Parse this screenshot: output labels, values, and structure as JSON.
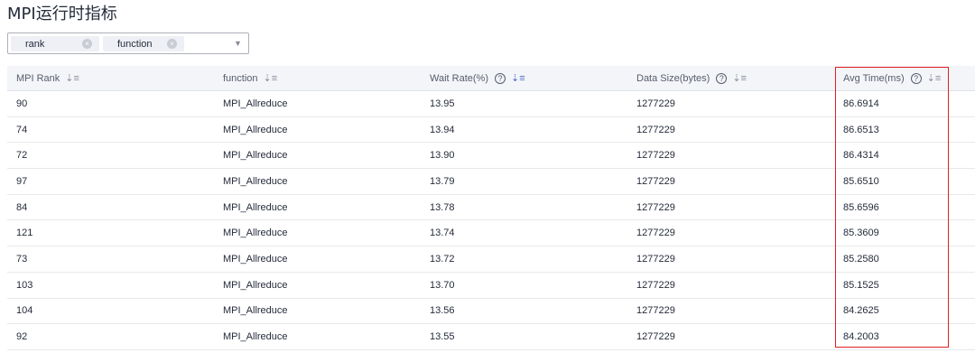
{
  "page": {
    "title": "MPI运行时指标"
  },
  "filter": {
    "tags": [
      {
        "label": "rank"
      },
      {
        "label": "function"
      }
    ],
    "close_glyph": "×",
    "arrow_icon": "chevron-down-icon"
  },
  "table": {
    "columns": [
      {
        "label": "MPI Rank",
        "help": false,
        "sort_active": false
      },
      {
        "label": "function",
        "help": false,
        "sort_active": false
      },
      {
        "label": "Wait Rate(%)",
        "help": true,
        "sort_active": true
      },
      {
        "label": "Data Size(bytes)",
        "help": true,
        "sort_active": false
      },
      {
        "label": "Avg Time(ms)",
        "help": true,
        "sort_active": false
      }
    ],
    "rows": [
      [
        "90",
        "MPI_Allreduce",
        "13.95",
        "1277229",
        "86.6914"
      ],
      [
        "74",
        "MPI_Allreduce",
        "13.94",
        "1277229",
        "86.6513"
      ],
      [
        "72",
        "MPI_Allreduce",
        "13.90",
        "1277229",
        "86.4314"
      ],
      [
        "97",
        "MPI_Allreduce",
        "13.79",
        "1277229",
        "85.6510"
      ],
      [
        "84",
        "MPI_Allreduce",
        "13.78",
        "1277229",
        "85.6596"
      ],
      [
        "121",
        "MPI_Allreduce",
        "13.74",
        "1277229",
        "85.3609"
      ],
      [
        "73",
        "MPI_Allreduce",
        "13.72",
        "1277229",
        "85.2580"
      ],
      [
        "103",
        "MPI_Allreduce",
        "13.70",
        "1277229",
        "85.1525"
      ],
      [
        "104",
        "MPI_Allreduce",
        "13.56",
        "1277229",
        "84.2625"
      ],
      [
        "92",
        "MPI_Allreduce",
        "13.55",
        "1277229",
        "84.2003"
      ]
    ]
  },
  "colors": {
    "highlight": "#e02020",
    "sort_active": "#526ecc",
    "header_bg": "#f3f5f9"
  }
}
